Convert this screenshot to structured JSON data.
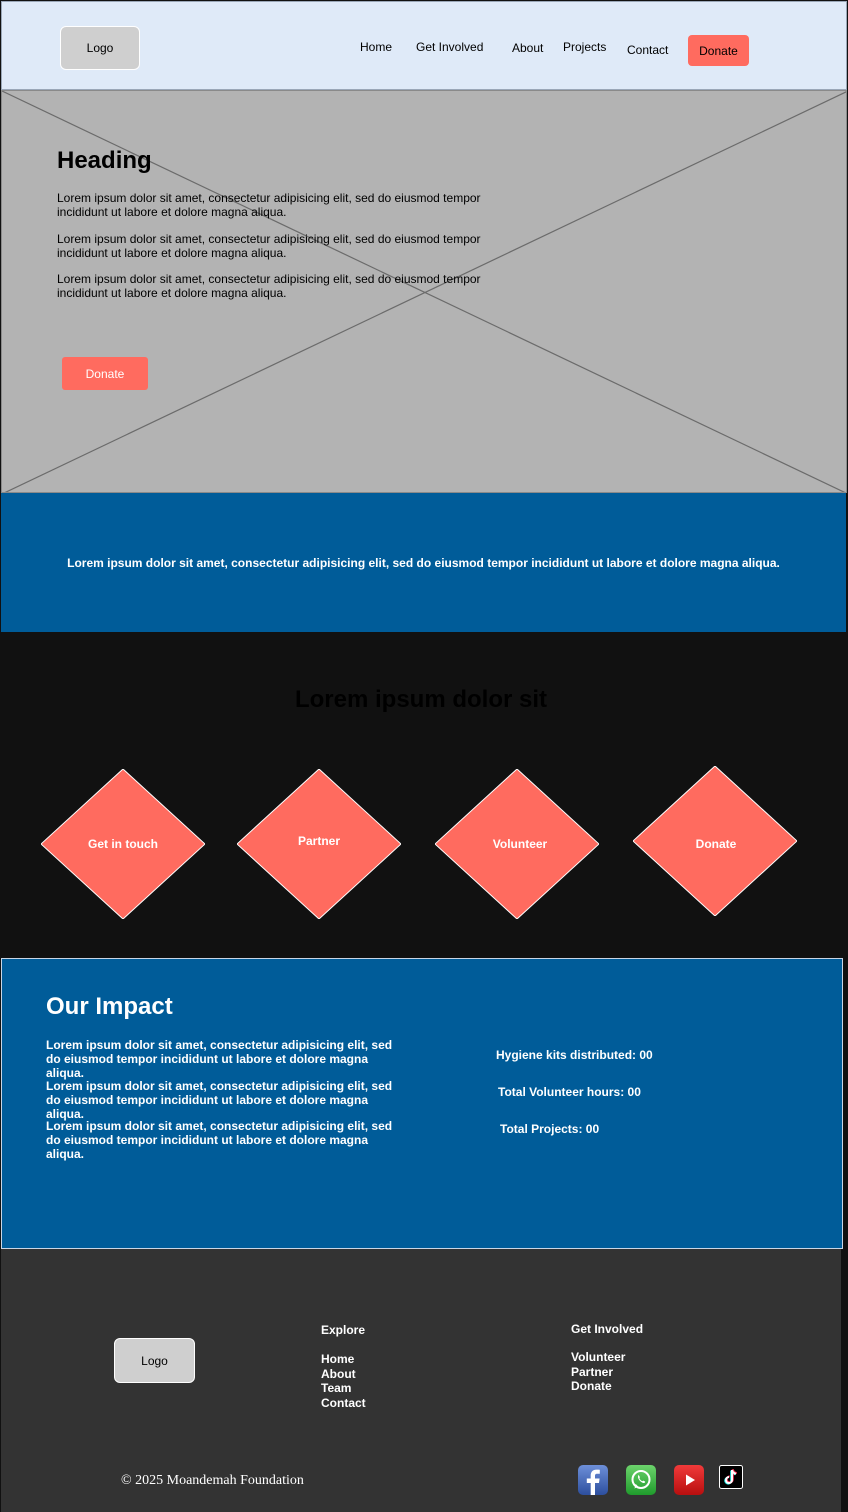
{
  "header": {
    "logo": "Logo",
    "nav": [
      "Home",
      "Get Involved",
      "About",
      "Projects",
      "Contact"
    ],
    "donate": "Donate"
  },
  "hero": {
    "heading": "Heading",
    "paragraphs": [
      "Lorem ipsum dolor sit amet, consectetur adipisicing elit, sed do eiusmod tempor incididunt ut labore et dolore magna aliqua.",
      "Lorem ipsum dolor sit amet, consectetur adipisicing elit, sed do eiusmod tempor incididunt ut labore et dolore magna aliqua.",
      "Lorem ipsum dolor sit amet, consectetur adipisicing elit, sed do eiusmod tempor incididunt ut labore et dolore magna aliqua."
    ],
    "button": "Donate"
  },
  "banner": {
    "text": "Lorem ipsum dolor sit amet, consectetur adipisicing elit, sed do eiusmod tempor incididunt ut labore et dolore magna aliqua."
  },
  "actions": {
    "heading": "Lorem ipsum dolor sit",
    "items": [
      "Get in touch",
      "Partner",
      "Volunteer",
      "Donate"
    ]
  },
  "impact": {
    "heading": "Our Impact",
    "paragraphs": [
      "Lorem ipsum dolor sit amet, consectetur adipisicing elit, sed do eiusmod tempor incididunt ut labore et dolore magna aliqua.",
      "Lorem ipsum dolor sit amet, consectetur adipisicing elit, sed do eiusmod tempor incididunt ut labore et dolore magna aliqua.",
      "Lorem ipsum dolor sit amet, consectetur adipisicing elit, sed do eiusmod tempor incididunt ut labore et dolore magna aliqua."
    ],
    "stats": [
      "Hygiene kits distributed: 00",
      "Total Volunteer hours: 00",
      "Total Projects: 00"
    ]
  },
  "footer": {
    "logo": "Logo",
    "explore_heading": "Explore",
    "explore_links": [
      "Home",
      "About",
      "Team",
      "Contact"
    ],
    "involved_heading": "Get Involved",
    "involved_links": [
      "Volunteer",
      "Partner",
      "Donate"
    ],
    "copyright": "© 2025 Moandemah Foundation",
    "social_icons": [
      "facebook-icon",
      "whatsapp-icon",
      "youtube-icon",
      "tiktok-icon"
    ]
  },
  "colors": {
    "header_bg": "#dfeaf8",
    "accent": "#ff6b5f",
    "blue": "#005c99",
    "dark": "#111111",
    "footer_bg": "#333333"
  }
}
